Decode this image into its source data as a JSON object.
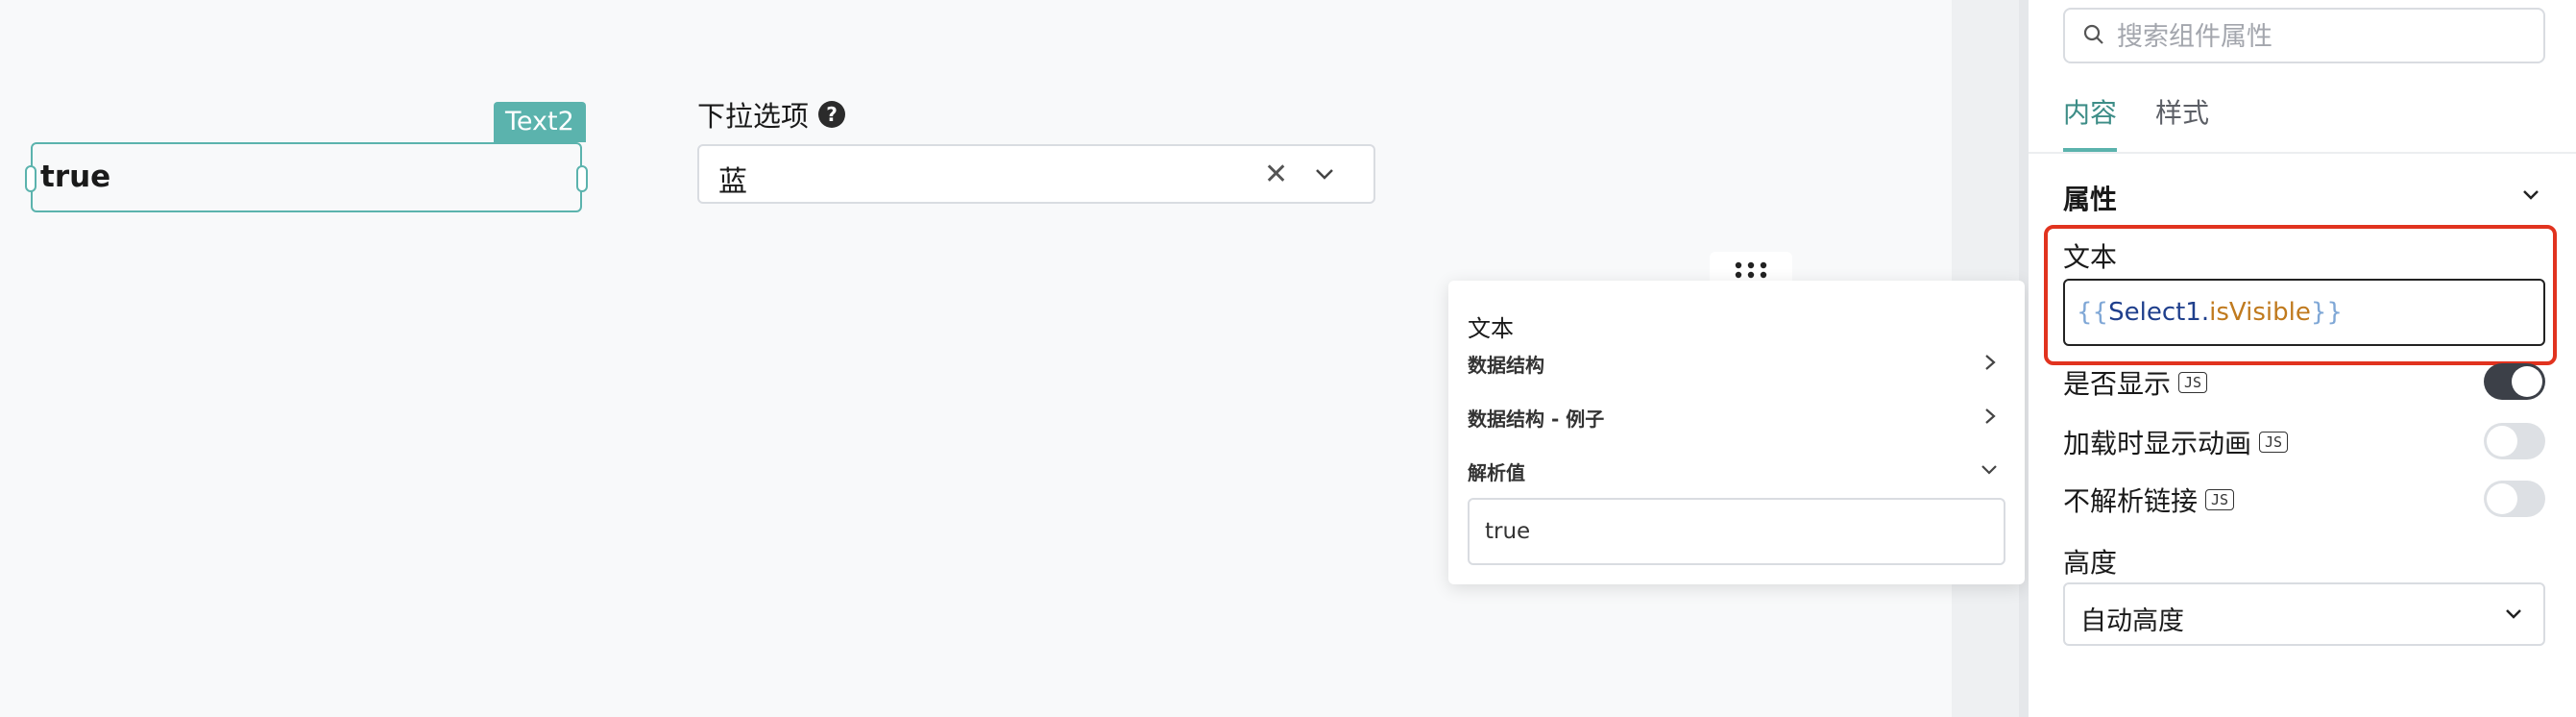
{
  "canvas": {
    "text_widget": {
      "tag": "Text2",
      "value": "true"
    },
    "select_widget": {
      "label": "下拉选项",
      "help_icon": "?",
      "value": "蓝"
    }
  },
  "eval_popup": {
    "title": "文本",
    "rows": [
      {
        "label": "数据结构",
        "icon": "chevron-right-icon"
      },
      {
        "label": "数据结构 - 例子",
        "icon": "chevron-right-icon"
      },
      {
        "label": "解析值",
        "icon": "chevron-down-icon"
      }
    ],
    "evaluated_value": "true"
  },
  "panel": {
    "search": {
      "placeholder": "搜索组件属性"
    },
    "tabs": [
      {
        "label": "内容",
        "active": true
      },
      {
        "label": "样式",
        "active": false
      }
    ],
    "section": {
      "title": "属性"
    },
    "text_field": {
      "label": "文本",
      "open_brace": "{{",
      "object": "Select1",
      "dot": ".",
      "property": "isVisible",
      "close_brace": "}}"
    },
    "toggles": [
      {
        "label": "是否显示",
        "badge": "JS",
        "on": true
      },
      {
        "label": "加载时显示动画",
        "badge": "JS",
        "on": false
      },
      {
        "label": "不解析链接",
        "badge": "JS",
        "on": false
      }
    ],
    "height": {
      "label": "高度",
      "value": "自动高度"
    }
  },
  "colors": {
    "accent": "#5bb3ad",
    "highlight": "#e1331f",
    "toggle_on": "#3c4048"
  }
}
